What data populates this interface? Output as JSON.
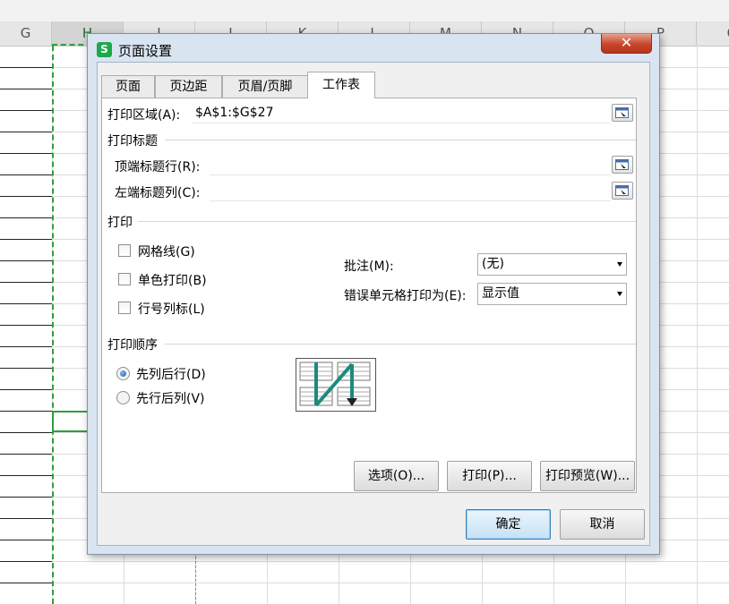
{
  "spreadsheet": {
    "column_headers": [
      "G",
      "H",
      "I",
      "J",
      "K",
      "L",
      "M",
      "N",
      "O",
      "P",
      "Q"
    ],
    "active_column": "H"
  },
  "dialog": {
    "app_icon": "S",
    "title": "页面设置",
    "close_label": "✕",
    "tabs": [
      {
        "label": "页面",
        "active": false
      },
      {
        "label": "页边距",
        "active": false
      },
      {
        "label": "页眉/页脚",
        "active": false
      },
      {
        "label": "工作表",
        "active": true
      }
    ],
    "print_area": {
      "label": "打印区域(A):",
      "value": "$A$1:$G$27"
    },
    "print_titles": {
      "section": "打印标题",
      "top_rows": {
        "label": "顶端标题行(R):",
        "value": ""
      },
      "left_cols": {
        "label": "左端标题列(C):",
        "value": ""
      }
    },
    "print": {
      "section": "打印",
      "gridlines": {
        "label": "网格线(G)",
        "checked": false
      },
      "mono": {
        "label": "单色打印(B)",
        "checked": false
      },
      "row_col_headers": {
        "label": "行号列标(L)",
        "checked": false
      },
      "comments": {
        "label": "批注(M):",
        "value": "(无)"
      },
      "errors": {
        "label": "错误单元格打印为(E):",
        "value": "显示值"
      }
    },
    "page_order": {
      "section": "打印顺序",
      "down_then_over": {
        "label": "先列后行(D)",
        "checked": true
      },
      "over_then_down": {
        "label": "先行后列(V)",
        "checked": false
      }
    },
    "buttons": {
      "options": "选项(O)...",
      "print": "打印(P)...",
      "preview": "打印预览(W)...",
      "ok": "确定",
      "cancel": "取消"
    },
    "icons": {
      "ref_button": "range-select-icon",
      "order_graphic": "page-order-icon"
    },
    "colors": {
      "accent_green": "#2e9e3e",
      "app_icon_green": "#1ca94b",
      "close_red": "#c7452b"
    }
  }
}
